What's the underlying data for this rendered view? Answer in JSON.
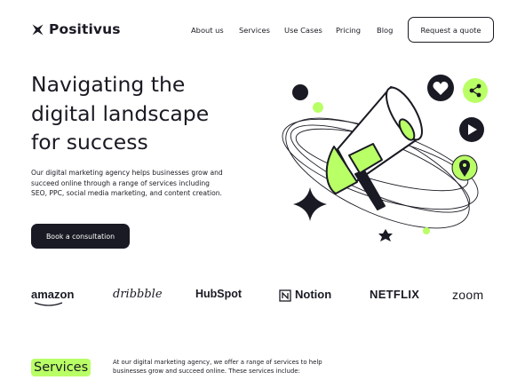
{
  "brand": {
    "name": "Positivus"
  },
  "nav": {
    "links": [
      "About us",
      "Services",
      "Use Cases",
      "Pricing",
      "Blog"
    ],
    "cta": "Request a quote"
  },
  "hero": {
    "title_lines": [
      "Navigating the",
      "digital landscape",
      "for success"
    ],
    "description": "Our digital marketing agency helps businesses grow and succeed online through a range of services including SEO, PPC, social media marketing, and content creation.",
    "cta": "Book a consultation"
  },
  "clients": [
    "amazon",
    "dribbble",
    "HubSpot",
    "Notion",
    "NETFLIX",
    "zoom"
  ],
  "services": {
    "heading": "Services",
    "description": "At our digital marketing agency, we offer a range of services to help businesses grow and succeed online. These services include:"
  },
  "colors": {
    "accent": "#B9FF66",
    "dark": "#191A23",
    "background": "#FFFFFF"
  },
  "icons": [
    "star-logo-icon",
    "megaphone-illustration",
    "heart-icon",
    "share-icon",
    "play-icon",
    "location-pin-icon",
    "sparkle-star-icon"
  ]
}
